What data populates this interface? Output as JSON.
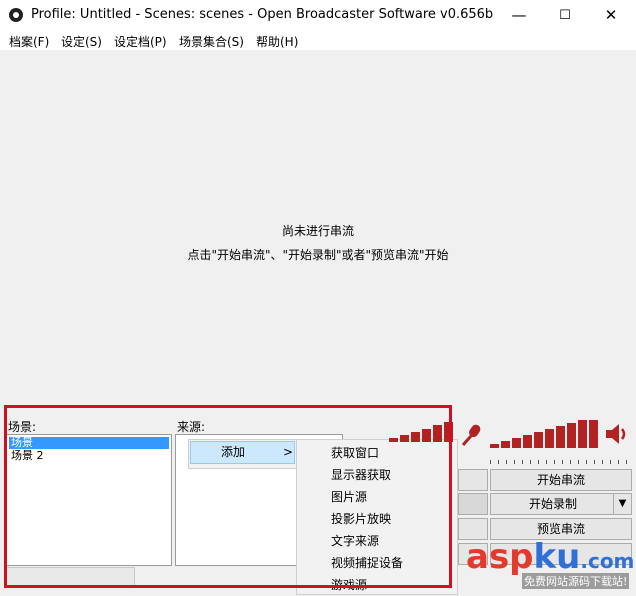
{
  "window": {
    "title": "Profile: Untitled - Scenes: scenes - Open Broadcaster Software v0.656b",
    "minimize": "—",
    "maximize": "☐",
    "close": "✕"
  },
  "menu": [
    {
      "label": "档案(F)"
    },
    {
      "label": "设定(S)"
    },
    {
      "label": "设定档(P)"
    },
    {
      "label": "场景集合(S)"
    },
    {
      "label": "帮助(H)"
    }
  ],
  "preview": {
    "line1": "尚未进行串流",
    "line2": "点击\"开始串流\"、\"开始录制\"或者\"预览串流\"开始"
  },
  "scenes": {
    "label": "场景:",
    "items": [
      "场景",
      "场景 2"
    ]
  },
  "sources": {
    "label": "来源:"
  },
  "context_menu": {
    "add": "添加",
    "add_arrow": ">",
    "submenu": [
      "获取窗口",
      "显示器获取",
      "图片源",
      "投影片放映",
      "文字来源",
      "视频捕捉设备",
      "游戏源"
    ]
  },
  "controls": {
    "start_stream": "开始串流",
    "start_record": "开始录制",
    "record_dropdown": "▼",
    "preview_stream": "预览串流"
  },
  "meters": {
    "mic_level": 0.85,
    "desktop_level": 0.9
  },
  "watermark": {
    "brand": "aspku.com",
    "tagline": "免费网站源码下载站!"
  },
  "colors": {
    "highlight_frame": "#d01020",
    "meter_red": "#b22222",
    "selection_blue": "#3399ff"
  }
}
